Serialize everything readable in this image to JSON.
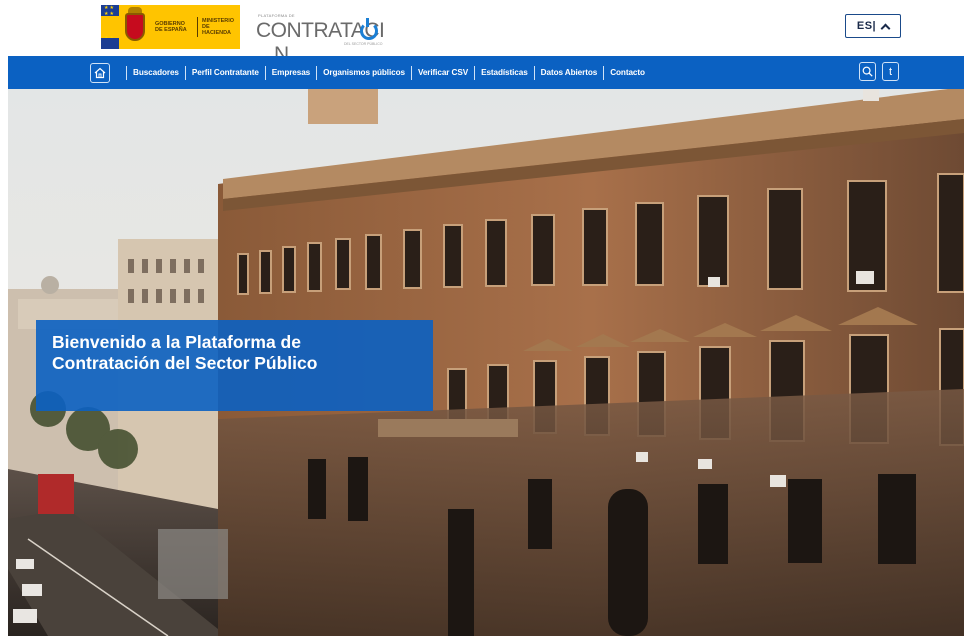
{
  "header": {
    "gov_logo": {
      "line1": "GOBIERNO",
      "line2": "DE ESPAÑA",
      "line3": "MINISTERIO",
      "line4": "DE HACIENDA"
    },
    "brand": {
      "small_text": "PLATAFORMA DE",
      "name_start": "CONTRATACI",
      "name_end": "N",
      "subtitle": "DEL SECTOR PÚBLICO"
    },
    "language": {
      "label": "ES|",
      "icon": "chevron-up-icon"
    }
  },
  "nav": {
    "home_icon": "home-icon",
    "items": [
      "Buscadores",
      "Perfil Contratante",
      "Empresas",
      "Organismos públicos",
      "Verificar CSV",
      "Estadísticas",
      "Datos Abiertos",
      "Contacto"
    ],
    "tools": {
      "search_icon": "search-icon",
      "info_label": "t"
    }
  },
  "hero": {
    "headline": "Bienvenido a la Plataforma de Contratación del Sector Público"
  },
  "colors": {
    "nav_blue": "#0b61c2",
    "brand_blue": "#1b7fd4",
    "header_bg": "#ffffff"
  }
}
